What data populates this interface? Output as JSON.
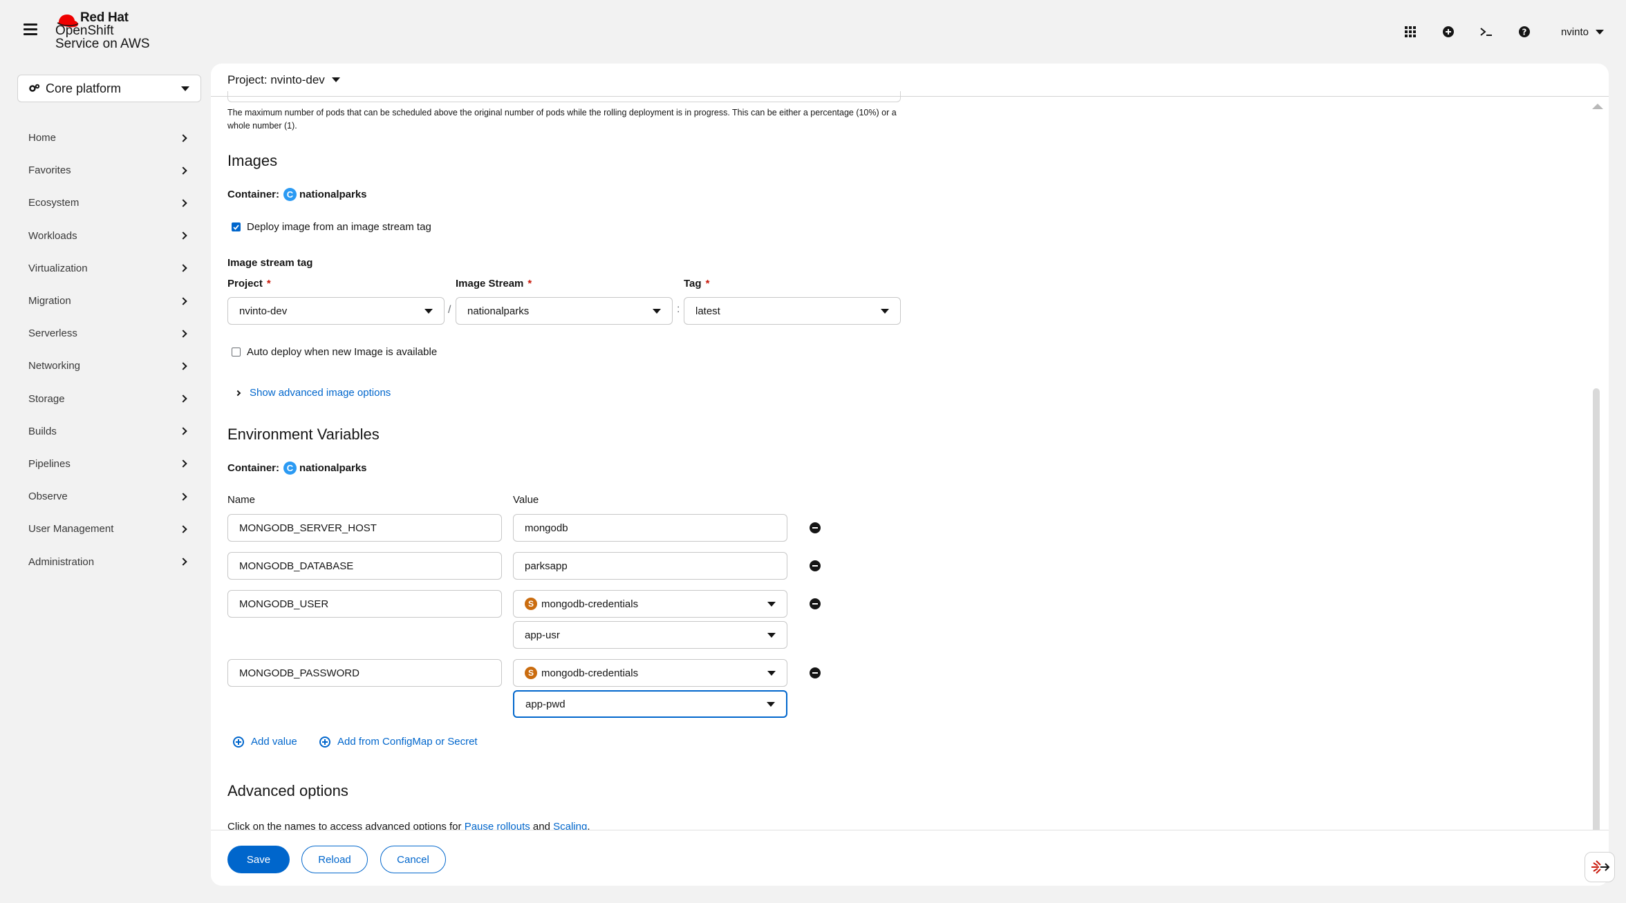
{
  "masthead": {
    "brand_line1": "Red Hat",
    "brand_line2": "OpenShift",
    "brand_line3": "Service on AWS",
    "user": "nvinto",
    "icons": [
      "hamburger-icon",
      "redhat-logo",
      "app-launcher-icon",
      "plus-circle-icon",
      "terminal-icon",
      "help-icon"
    ]
  },
  "sidebar": {
    "perspective": "Core platform",
    "items": [
      {
        "label": "Home"
      },
      {
        "label": "Favorites"
      },
      {
        "label": "Ecosystem"
      },
      {
        "label": "Workloads"
      },
      {
        "label": "Virtualization"
      },
      {
        "label": "Migration"
      },
      {
        "label": "Serverless"
      },
      {
        "label": "Networking"
      },
      {
        "label": "Storage"
      },
      {
        "label": "Builds"
      },
      {
        "label": "Pipelines"
      },
      {
        "label": "Observe"
      },
      {
        "label": "User Management"
      },
      {
        "label": "Administration"
      }
    ]
  },
  "project_bar": {
    "label": "Project: nvinto-dev"
  },
  "form": {
    "max_surge_help": "The maximum number of pods that can be scheduled above the original number of pods while the rolling deployment is in progress. This can be either a percentage (10%) or a whole number (1).",
    "images": {
      "heading": "Images",
      "container_label": "Container:",
      "container_badge": "C",
      "container_name": "nationalparks",
      "deploy_from_ist_label": "Deploy image from an image stream tag",
      "deploy_from_ist_checked": true,
      "ist_heading": "Image stream tag",
      "project_label": "Project",
      "project_value": "nvinto-dev",
      "image_stream_label": "Image Stream",
      "image_stream_value": "nationalparks",
      "tag_label": "Tag",
      "tag_value": "latest",
      "required_mark": "*",
      "sep_slash": "/",
      "sep_colon": ":",
      "auto_deploy_label": "Auto deploy when new Image is available",
      "auto_deploy_checked": false,
      "advanced_link": "Show advanced image options"
    },
    "env": {
      "heading": "Environment Variables",
      "container_label": "Container:",
      "container_badge": "C",
      "container_name": "nationalparks",
      "col_name": "Name",
      "col_value": "Value",
      "secret_badge": "S",
      "rows": [
        {
          "name": "MONGODB_SERVER_HOST",
          "value": "mongodb"
        },
        {
          "name": "MONGODB_DATABASE",
          "value": "parksapp"
        },
        {
          "name": "MONGODB_USER",
          "secret": "mongodb-credentials",
          "key": "app-usr"
        },
        {
          "name": "MONGODB_PASSWORD",
          "secret": "mongodb-credentials",
          "key": "app-pwd"
        }
      ],
      "add_value": "Add value",
      "add_from": "Add from ConfigMap or Secret"
    },
    "advanced": {
      "heading": "Advanced options",
      "text_before": "Click on the names to access advanced options for ",
      "link1": "Pause rollouts",
      "text_mid": " and ",
      "link2": "Scaling",
      "text_after": "."
    }
  },
  "footer": {
    "save": "Save",
    "reload": "Reload",
    "cancel": "Cancel"
  },
  "colors": {
    "primary": "#0066cc",
    "secret_badge": "#ca6c0f",
    "container_badge": "#2b9af3",
    "required": "#c9190b"
  }
}
